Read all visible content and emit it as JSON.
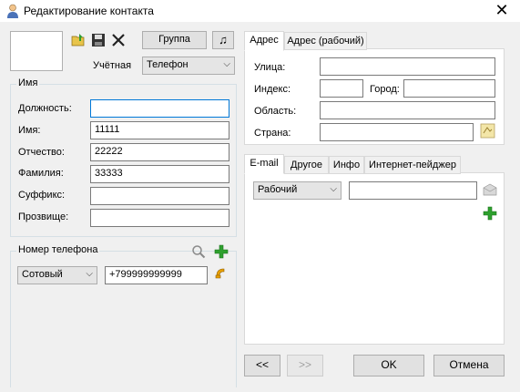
{
  "window": {
    "title": "Редактирование контакта",
    "close_glyph": "✕"
  },
  "toolbar": {
    "group_label": "Группа",
    "music_glyph": "♫"
  },
  "account": {
    "label": "Учётная",
    "value": "Телефон"
  },
  "name_group": {
    "legend": "Имя",
    "fields": [
      {
        "label": "Должность:",
        "value": ""
      },
      {
        "label": "Имя:",
        "value": "11111"
      },
      {
        "label": "Отчество:",
        "value": "22222"
      },
      {
        "label": "Фамилия:",
        "value": "33333"
      },
      {
        "label": "Суффикс:",
        "value": ""
      },
      {
        "label": "Прозвище:",
        "value": ""
      }
    ]
  },
  "phone_group": {
    "legend": "Номер телефона",
    "type": "Сотовый",
    "number": "+799999999999"
  },
  "address_tabs": {
    "tabs": [
      "Адрес",
      "Адрес (рабочий)"
    ],
    "street_label": "Улица:",
    "street": "",
    "index_label": "Индекс:",
    "index": "",
    "city_label": "Город:",
    "city": "",
    "region_label": "Область:",
    "region": "",
    "country_label": "Страна:",
    "country": ""
  },
  "contact_tabs": {
    "tabs": [
      "E-mail",
      "Другое",
      "Инфо",
      "Интернет-пейджер"
    ],
    "email_type": "Рабочий",
    "email": ""
  },
  "footer": {
    "prev": "<<",
    "next": ">>",
    "ok": "OK",
    "cancel": "Отмена"
  },
  "colors": {
    "focus_border": "#0078d7",
    "add_green": "#2ea02e",
    "phone_orange": "#e8a000"
  }
}
